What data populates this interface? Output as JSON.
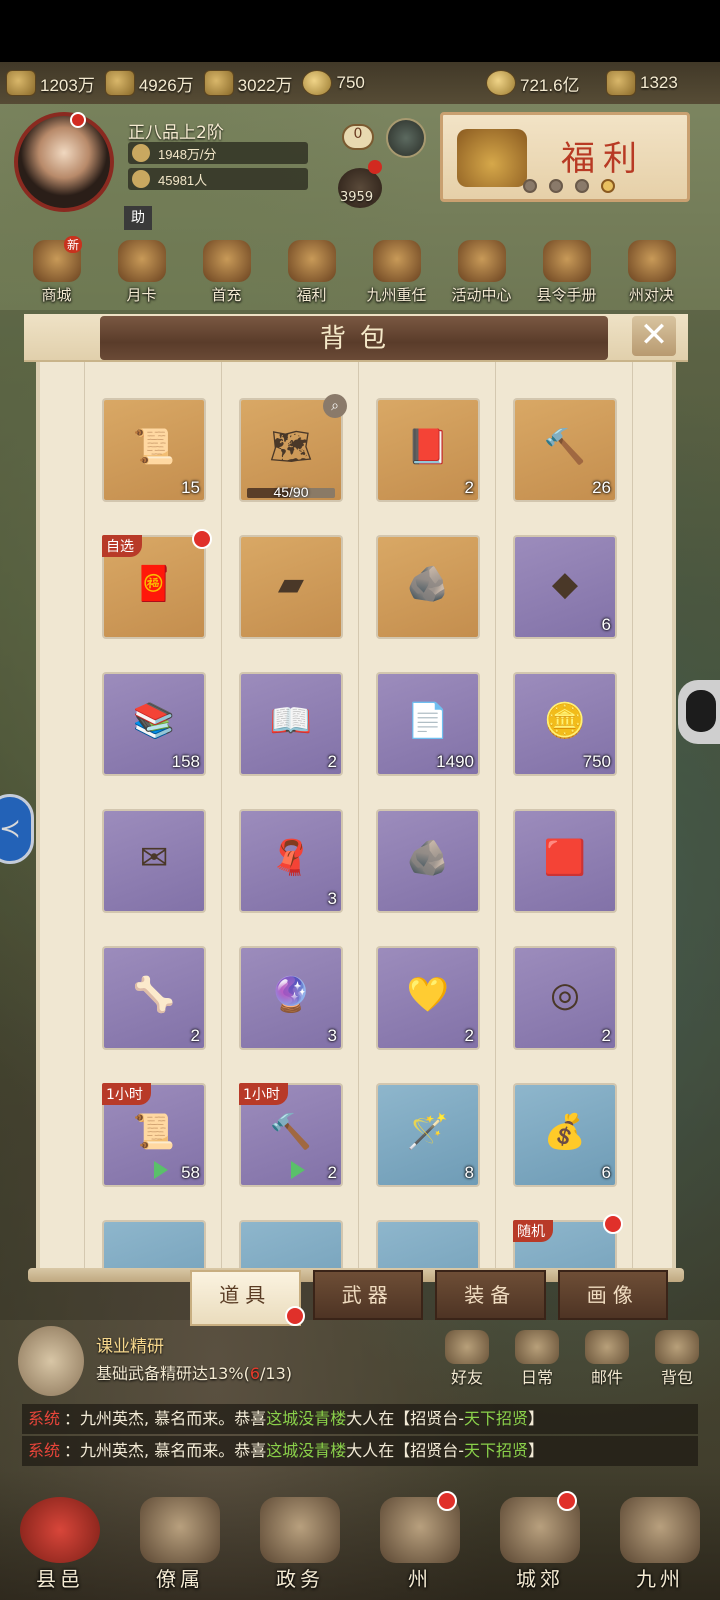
{
  "resources": [
    {
      "icon": "wood-logs-icon",
      "value": "1203万"
    },
    {
      "icon": "lumber-icon",
      "value": "4926万"
    },
    {
      "icon": "ore-pile-icon",
      "value": "3022万"
    },
    {
      "icon": "coin-add-icon",
      "value": "750"
    },
    {
      "icon": "copper-coin-icon",
      "value": "721.6亿"
    },
    {
      "icon": "ingot-add-icon",
      "value": "1323"
    }
  ],
  "player": {
    "rank": "正八品上2阶",
    "income": "1948万/分",
    "population": "45981人",
    "helper_label": "助",
    "badge_zero": "0",
    "people_count": "3959"
  },
  "banner": {
    "title": "福利"
  },
  "top_menu": [
    {
      "label": "商城",
      "badge": "新"
    },
    {
      "label": "月卡"
    },
    {
      "label": "首充"
    },
    {
      "label": "福利"
    },
    {
      "label": "九州重任"
    },
    {
      "label": "活动中心"
    },
    {
      "label": "县令手册"
    },
    {
      "label": "州对决"
    }
  ],
  "backpack": {
    "title": "背包",
    "items": [
      {
        "color": "tan",
        "icon": "statue-scroll-icon",
        "glyph": "📜",
        "count": "15"
      },
      {
        "color": "tan",
        "icon": "map-chest-icon",
        "glyph": "🗺",
        "progress_text": "45/90",
        "progress": 0.5,
        "search": true
      },
      {
        "color": "tan",
        "icon": "book-icon",
        "glyph": "📕",
        "count": "2"
      },
      {
        "color": "tan",
        "icon": "scroll-hammer-icon",
        "glyph": "🔨",
        "count": "26"
      },
      {
        "color": "tan",
        "icon": "choice-chest-icon",
        "glyph": "🧧",
        "tag": "自选",
        "reddot": true
      },
      {
        "color": "tan",
        "icon": "iron-ingot-icon",
        "glyph": "▰"
      },
      {
        "color": "tan",
        "icon": "ore-chunk-icon",
        "glyph": "🪨"
      },
      {
        "color": "purple",
        "icon": "crystal-ore-icon",
        "glyph": "◆",
        "count": "6"
      },
      {
        "color": "purple",
        "icon": "books-stack-icon",
        "glyph": "📚",
        "count": "158"
      },
      {
        "color": "purple",
        "icon": "manual-book-icon",
        "glyph": "📖",
        "count": "2"
      },
      {
        "color": "purple",
        "icon": "notice-paper-icon",
        "glyph": "📄",
        "count": "1490"
      },
      {
        "color": "purple",
        "icon": "gold-coin-icon",
        "glyph": "🪙",
        "count": "750"
      },
      {
        "color": "purple",
        "icon": "rename-card-icon",
        "glyph": "✉",
        "count": ""
      },
      {
        "color": "purple",
        "icon": "silk-cloth-icon",
        "glyph": "🧣",
        "count": "3"
      },
      {
        "color": "purple",
        "icon": "ore-chunk-icon",
        "glyph": "🪨"
      },
      {
        "color": "purple",
        "icon": "brocade-icon",
        "glyph": "🟥"
      },
      {
        "color": "purple",
        "icon": "bone-icon",
        "glyph": "🦴",
        "count": "2"
      },
      {
        "color": "purple",
        "icon": "orb-icon",
        "glyph": "🔮",
        "count": "3"
      },
      {
        "color": "purple",
        "icon": "gold-ore-icon",
        "glyph": "💛",
        "count": "2"
      },
      {
        "color": "purple",
        "icon": "jade-disc-icon",
        "glyph": "◎",
        "count": "2"
      },
      {
        "color": "purple",
        "icon": "scroll-speedup-icon",
        "glyph": "📜",
        "tag": "1小时",
        "count": "58",
        "arrow": true
      },
      {
        "color": "purple",
        "icon": "hammer-speedup-icon",
        "glyph": "🔨",
        "tag": "1小时",
        "count": "2",
        "arrow": true
      },
      {
        "color": "blue",
        "icon": "ruyi-scepter-icon",
        "glyph": "🪄",
        "count": "8"
      },
      {
        "color": "blue",
        "icon": "gold-pouch-icon",
        "glyph": "💰",
        "count": "6"
      }
    ],
    "partial_row": [
      {
        "color": "blue"
      },
      {
        "color": "blue"
      },
      {
        "color": "blue"
      },
      {
        "color": "blue",
        "tag": "随机",
        "reddot": true
      }
    ]
  },
  "tabs": [
    {
      "label": "道具",
      "active": true
    },
    {
      "label": "武器"
    },
    {
      "label": "装备"
    },
    {
      "label": "画像"
    }
  ],
  "quest": {
    "title": "课业精研",
    "desc_prefix": "基础武备精研达13%(",
    "desc_current": "6",
    "desc_suffix": "/13)"
  },
  "side_buttons": [
    {
      "label": "好友"
    },
    {
      "label": "日常"
    },
    {
      "label": "邮件"
    },
    {
      "label": "背包"
    }
  ],
  "chat": [
    {
      "channel": "系统",
      "pre": "：九州英杰, 慕名而来。恭喜",
      "name": "这城没青楼",
      "mid": "大人在【招贤台-",
      "place": "天下招贤",
      "post": "】"
    },
    {
      "channel": "系统",
      "pre": "：九州英杰, 慕名而来。恭喜",
      "name": "这城没青楼",
      "mid": "大人在【招贤台-",
      "place": "天下招贤",
      "post": "】"
    }
  ],
  "bottom_nav": [
    {
      "label": "县邑",
      "active": true
    },
    {
      "label": "僚属"
    },
    {
      "label": "政务"
    },
    {
      "label": "州",
      "reddot": true
    },
    {
      "label": "城郊",
      "reddot": true
    },
    {
      "label": "九州"
    }
  ]
}
